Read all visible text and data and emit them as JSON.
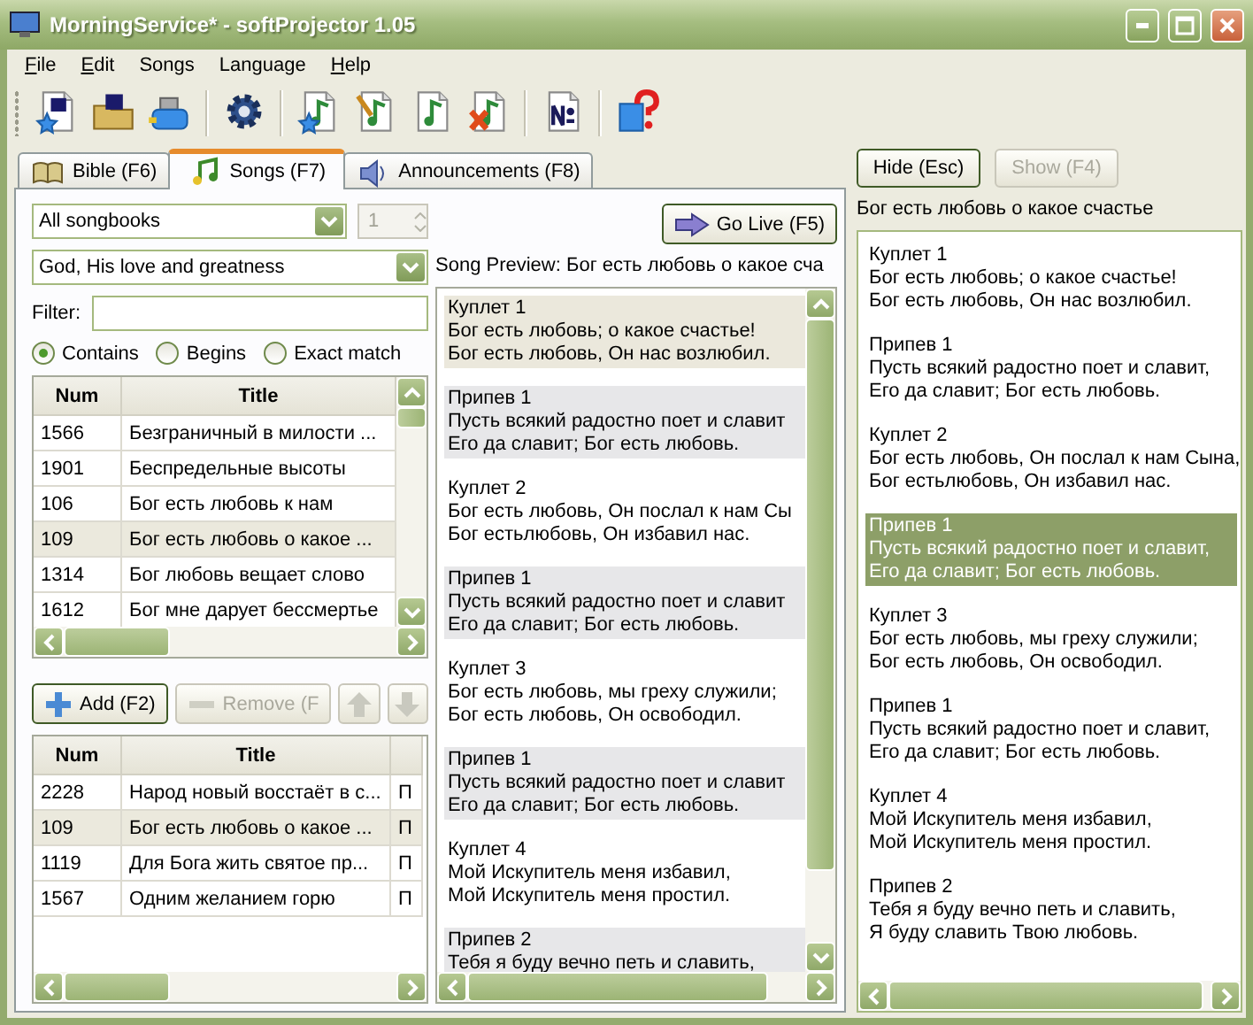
{
  "window": {
    "title": "MorningService* - softProjector 1.05"
  },
  "menu": [
    {
      "label": "File",
      "underline_first": true
    },
    {
      "label": "Edit",
      "underline_first": true
    },
    {
      "label": "Songs",
      "underline_first": false
    },
    {
      "label": "Language",
      "underline_first": false
    },
    {
      "label": "Help",
      "underline_first": true
    }
  ],
  "tabs": [
    {
      "label": "Bible (F6)",
      "selected": false
    },
    {
      "label": "Songs (F7)",
      "selected": true
    },
    {
      "label": "Announcements (F8)",
      "selected": false
    }
  ],
  "songbook": {
    "value": "All songbooks"
  },
  "song_number": {
    "value": "1",
    "disabled": true
  },
  "category": {
    "value": "God, His love and greatness"
  },
  "filter": {
    "label": "Filter:"
  },
  "match_modes": [
    {
      "label": "Contains",
      "selected": true
    },
    {
      "label": "Begins",
      "selected": false
    },
    {
      "label": "Exact match",
      "selected": false
    }
  ],
  "songs_table": {
    "columns": [
      "Num",
      "Title"
    ],
    "rows": [
      {
        "cells": [
          "1566",
          "Безграничный в милости ..."
        ],
        "selected": false
      },
      {
        "cells": [
          "1901",
          "Беспредельные высоты"
        ],
        "selected": false
      },
      {
        "cells": [
          "106",
          "Бог есть любовь к нам"
        ],
        "selected": false
      },
      {
        "cells": [
          "109",
          "Бог есть любовь о какое ..."
        ],
        "selected": true
      },
      {
        "cells": [
          "1314",
          "Бог любовь вещает слово"
        ],
        "selected": false
      },
      {
        "cells": [
          "1612",
          "Бог мне дарует бессмертье"
        ],
        "selected": false
      }
    ]
  },
  "playlist_buttons": [
    {
      "kind": "add",
      "label": "Add (F2)",
      "disabled": false
    },
    {
      "kind": "remove",
      "label": "Remove (F",
      "disabled": true
    },
    {
      "kind": "up",
      "disabled": true
    },
    {
      "kind": "down",
      "disabled": true
    }
  ],
  "playlist_table": {
    "columns": [
      "Num",
      "Title"
    ],
    "rows": [
      {
        "cells": [
          "2228",
          "Народ новый восстаёт в с...",
          "П"
        ],
        "selected": false
      },
      {
        "cells": [
          "109",
          "Бог есть любовь о какое ...",
          "П"
        ],
        "selected": true
      },
      {
        "cells": [
          "1119",
          "Для Бога жить святое пр...",
          "П"
        ],
        "selected": false
      },
      {
        "cells": [
          "1567",
          "Одним желанием горю",
          "П"
        ],
        "selected": false
      }
    ]
  },
  "go_live": {
    "label": "Go Live (F5)"
  },
  "preview": {
    "label": "Song Preview: Бог есть любовь о какое сча",
    "items": [
      {
        "kind": "verse",
        "title": "Куплет 1",
        "lines": [
          "Бог есть любовь; о какое счастье!",
          "Бог есть любовь, Он нас возлюбил."
        ],
        "selected": true
      },
      {
        "kind": "chorus",
        "title": "Припев 1",
        "lines": [
          "Пусть всякий радостно поет и славит",
          "Его да славит; Бог есть любовь."
        ],
        "selected": false
      },
      {
        "kind": "verse",
        "title": "Куплет 2",
        "lines": [
          "Бог есть любовь, Он послал к нам Сы",
          "Бог естьлюбовь, Он избавил нас."
        ],
        "selected": false
      },
      {
        "kind": "chorus",
        "title": "Припев 1",
        "lines": [
          "Пусть всякий радостно поет и славит",
          "Его да славит; Бог есть любовь."
        ],
        "selected": false
      },
      {
        "kind": "verse",
        "title": "Куплет 3",
        "lines": [
          "Бог есть любовь, мы греху служили;",
          "Бог есть любовь, Он освободил."
        ],
        "selected": false
      },
      {
        "kind": "chorus",
        "title": "Припев 1",
        "lines": [
          "Пусть всякий радостно поет и славит",
          "Его да славит; Бог есть любовь."
        ],
        "selected": false
      },
      {
        "kind": "verse",
        "title": "Куплет 4",
        "lines": [
          "Мой Искупитель меня избавил,",
          "Мой Искупитель меня простил."
        ],
        "selected": false
      },
      {
        "kind": "chorus",
        "title": "Припев 2",
        "lines": [
          "Тебя я буду вечно петь и славить,"
        ],
        "selected": false
      }
    ]
  },
  "live": {
    "buttons": [
      {
        "label": "Hide (Esc)",
        "disabled": false
      },
      {
        "label": "Show (F4)",
        "disabled": true
      }
    ],
    "title": "Бог есть любовь о какое счастье",
    "items": [
      {
        "title": "Куплет 1",
        "lines": [
          "Бог есть любовь; о какое счастье!",
          "Бог есть любовь, Он нас возлюбил."
        ],
        "selected": false
      },
      {
        "title": "Припев 1",
        "lines": [
          "Пусть всякий радостно поет и славит,",
          "Его да славит; Бог есть любовь."
        ],
        "selected": false
      },
      {
        "title": "Куплет 2",
        "lines": [
          "Бог есть любовь, Он послал к нам Сына,",
          "Бог естьлюбовь, Он избавил нас."
        ],
        "selected": false
      },
      {
        "title": "Припев 1",
        "lines": [
          "Пусть всякий радостно поет и славит,",
          "Его да славит; Бог есть любовь."
        ],
        "selected": true
      },
      {
        "title": "Куплет 3",
        "lines": [
          "Бог есть любовь, мы греху служили;",
          "Бог есть любовь, Он освободил."
        ],
        "selected": false
      },
      {
        "title": "Припев 1",
        "lines": [
          "Пусть всякий радостно поет и славит,",
          "Его да славит; Бог есть любовь."
        ],
        "selected": false
      },
      {
        "title": "Куплет 4",
        "lines": [
          "Мой Искупитель меня избавил,",
          "Мой Искупитель меня простил."
        ],
        "selected": false
      },
      {
        "title": "Припев 2",
        "lines": [
          "Тебя я буду вечно петь и славить,",
          "Я буду славить Твою любовь."
        ],
        "selected": false
      }
    ]
  }
}
